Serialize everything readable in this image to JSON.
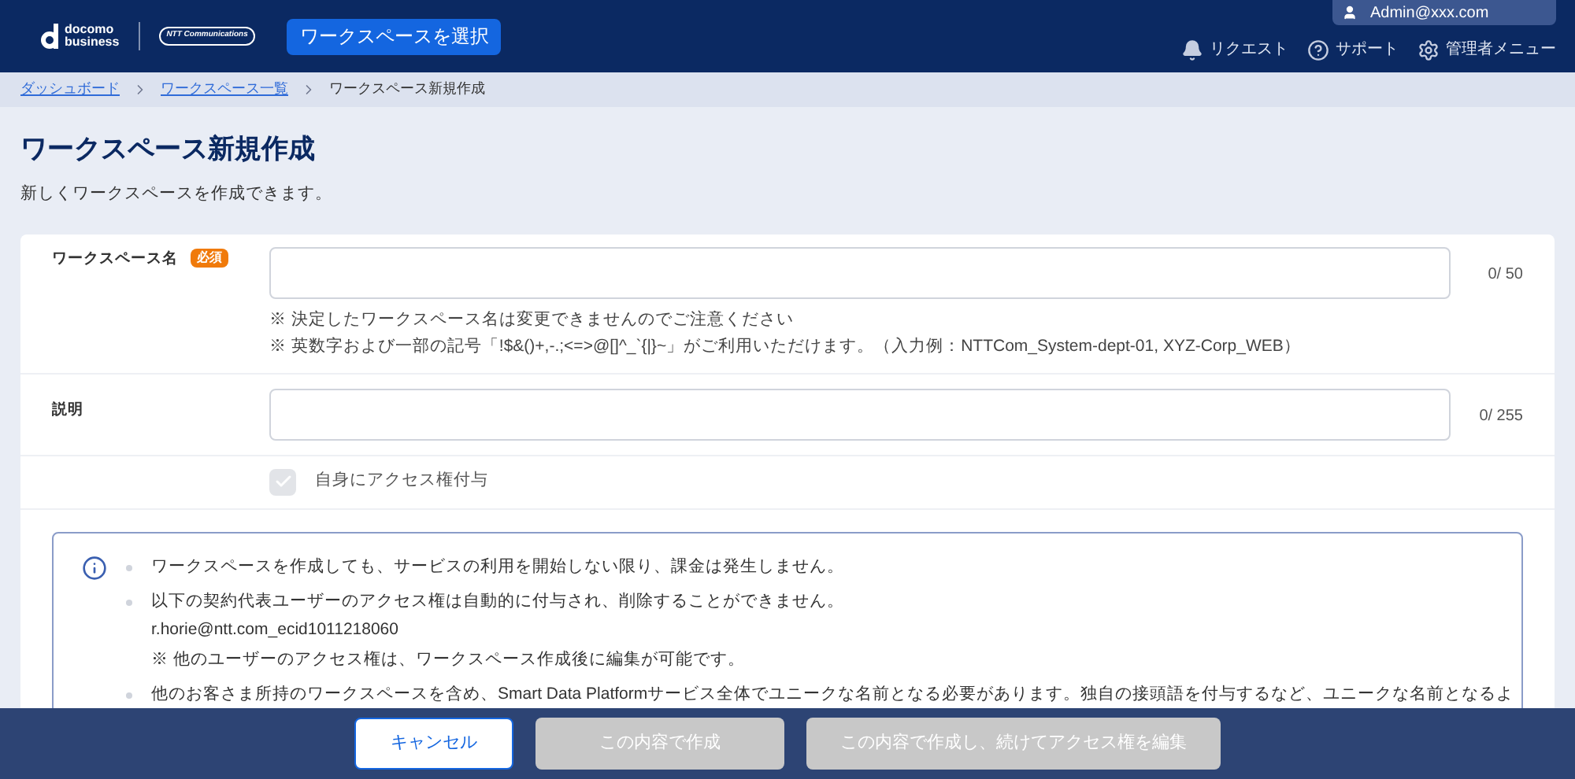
{
  "header": {
    "logo_top": "docomo",
    "logo_bottom": "business",
    "partner_logo": "NTT Communications",
    "workspace_button": "ワークスペースを選択",
    "user": "Admin@xxx.com",
    "nav": [
      {
        "kind": "bell",
        "label": "リクエスト"
      },
      {
        "kind": "help",
        "label": "サポート"
      },
      {
        "kind": "gear",
        "label": "管理者メニュー"
      }
    ]
  },
  "breadcrumb": [
    {
      "label": "ダッシュボード",
      "link": true
    },
    {
      "label": "ワークスペース一覧",
      "link": true
    },
    {
      "label": "ワークスペース新規作成",
      "link": false
    }
  ],
  "page": {
    "title": "ワークスペース新規作成",
    "subtitle": "新しくワークスペースを作成できます。"
  },
  "form": {
    "name_field": {
      "label": "ワークスペース名",
      "required_badge": "必須",
      "counter": "0/ 50",
      "notes": [
        "※ 決定したワークスペース名は変更できませんのでご注意ください",
        "※ 英数字および一部の記号「!$&()+,-.;<=>@[]^_`{|}~」がご利用いただけます。（入力例：NTTCom_System-dept-01, XYZ-Corp_WEB）"
      ]
    },
    "description_field": {
      "label": "説明",
      "counter": "0/ 255"
    },
    "self_access": {
      "label": "自身にアクセス権付与",
      "checked": true,
      "disabled": true
    }
  },
  "info": {
    "items": [
      {
        "lines": [
          "ワークスペースを作成しても、サービスの利用を開始しない限り、課金は発生しません。"
        ]
      },
      {
        "lines": [
          "以下の契約代表ユーザーのアクセス権は自動的に付与され、削除することができません。",
          "r.horie@ntt.com_ecid1011218060",
          "※ 他のユーザーのアクセス権は、ワークスペース作成後に編集が可能です。"
        ]
      },
      {
        "lines": [
          "他のお客さま所持のワークスペースを含め、Smart Data Platformサービス全体でユニークな名前となる必要があります。独自の接頭語を付与するなど、ユニークな名前となるよ"
        ]
      }
    ]
  },
  "footer": {
    "buttons": [
      {
        "label": "キャンセル",
        "disabled": false
      },
      {
        "label": "この内容で作成",
        "disabled": true
      },
      {
        "label": "この内容で作成し、続けてアクセス権を編集",
        "disabled": true
      }
    ]
  }
}
